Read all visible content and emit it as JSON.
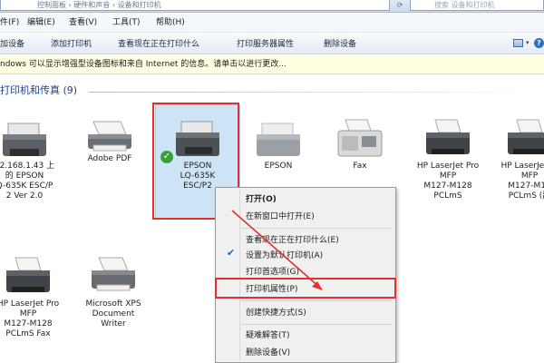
{
  "address_bar": {
    "path": "控制面板 › 硬件和声音 › 设备和打印机",
    "search_placeholder": "搜索 设备和打印机"
  },
  "menubar": {
    "items": [
      "件(F)",
      "编辑(E)",
      "查看(V)",
      "工具(T)",
      "帮助(H)"
    ]
  },
  "toolbar": {
    "items": [
      "加设备",
      "添加打印机",
      "查看现在正在打印什么",
      "打印服务器属性",
      "删除设备"
    ]
  },
  "infobar": {
    "text": "ndows 可以显示增强型设备图标和来自 Internet 的信息。请单击以进行更改..."
  },
  "group": {
    "title": "打印机和传真 (9)"
  },
  "devices": [
    {
      "label": "92.168.1.43 上\n的 EPSON\nQ-635K ESC/P\n2 Ver 2.0",
      "icon": "printer-icon"
    },
    {
      "label": "Adobe PDF",
      "icon": "printer-icon"
    },
    {
      "label": "EPSON\nLQ-635K\nESC/P2",
      "icon": "printer-icon",
      "default": true
    },
    {
      "label": "EPSON",
      "icon": "printer-icon"
    },
    {
      "label": "Fax",
      "icon": "fax-icon"
    },
    {
      "label": "HP LaserJet Pro\nMFP\nM127-M128\nPCLmS",
      "icon": "printer-icon"
    },
    {
      "label": "HP LaserJet Pr\nMFP\nM127-M12\nPCLmS (副",
      "icon": "printer-icon"
    },
    {
      "label": "HP LaserJet Pro\nMFP\nM127-M128\nPCLmS Fax",
      "icon": "printer-icon"
    },
    {
      "label": "Microsoft XPS\nDocument\nWriter",
      "icon": "printer-icon"
    }
  ],
  "context_menu": {
    "items": [
      {
        "label": "打开(O)",
        "bold": true
      },
      {
        "label": "在新窗口中打开(E)"
      },
      {
        "label": "查看现在正在打印什么(E)"
      },
      {
        "label": "设置为默认打印机(A)",
        "checked": true
      },
      {
        "label": "打印首选项(G)"
      },
      {
        "label": "打印机属性(P)",
        "highlighted": true
      },
      {
        "label": "创建快捷方式(S)"
      },
      {
        "label": "疑难解答(T)"
      },
      {
        "label": "删除设备(V)"
      }
    ]
  },
  "colors": {
    "highlight_box": "#e0312f",
    "selection": "#cde4f7",
    "group_header": "#1e3e8c"
  }
}
